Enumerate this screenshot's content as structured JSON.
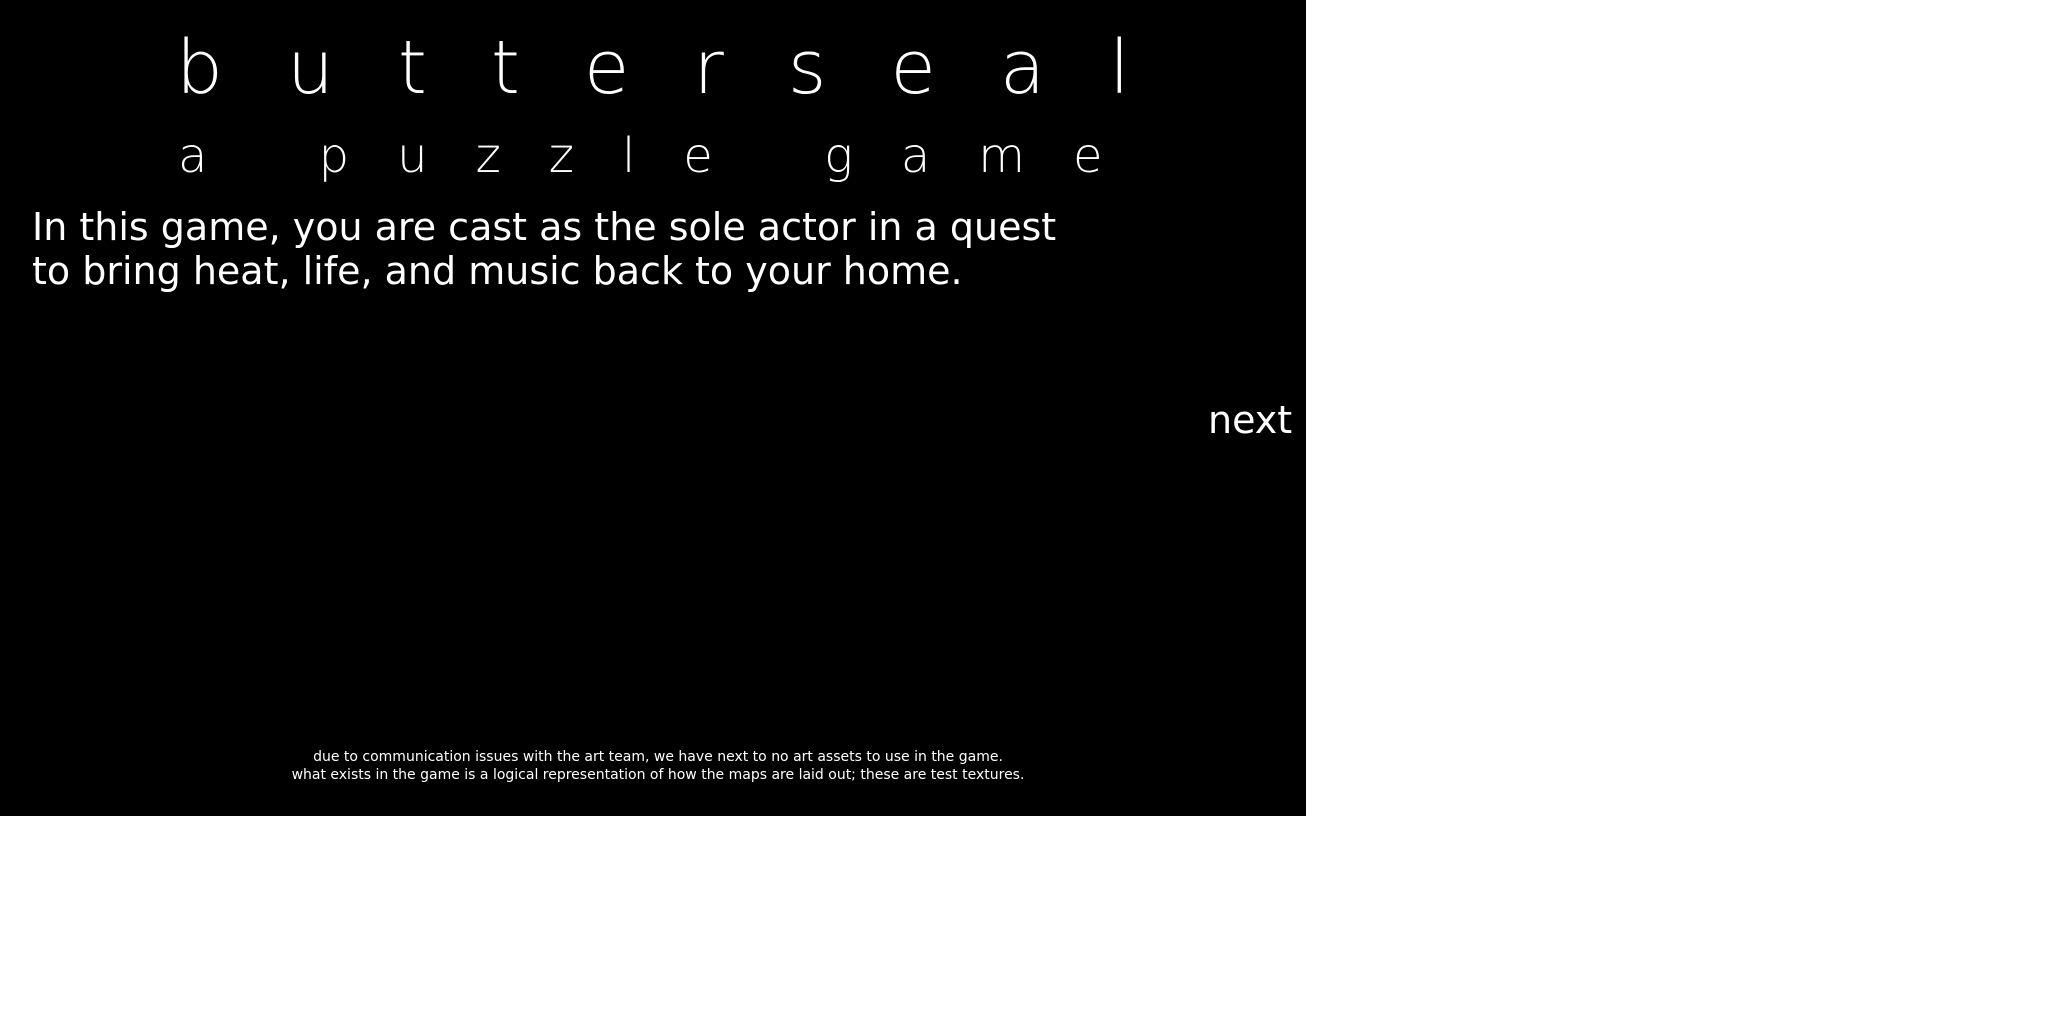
{
  "game": {
    "title": "butterseal",
    "subtitle": "a puzzle game",
    "intro_lines": [
      "In this game, you are cast as the sole actor in a quest",
      "to bring heat, life, and music back to your home."
    ],
    "next_label": "next",
    "notice_lines": [
      "due to communication issues with the art team, we have next to no art assets to use in the game.",
      "what exists in the game is a logical representation of how the maps are laid out; these are test textures."
    ],
    "colors": {
      "background": "#000000",
      "text": "#ffffff",
      "page": "#ffffff"
    }
  }
}
